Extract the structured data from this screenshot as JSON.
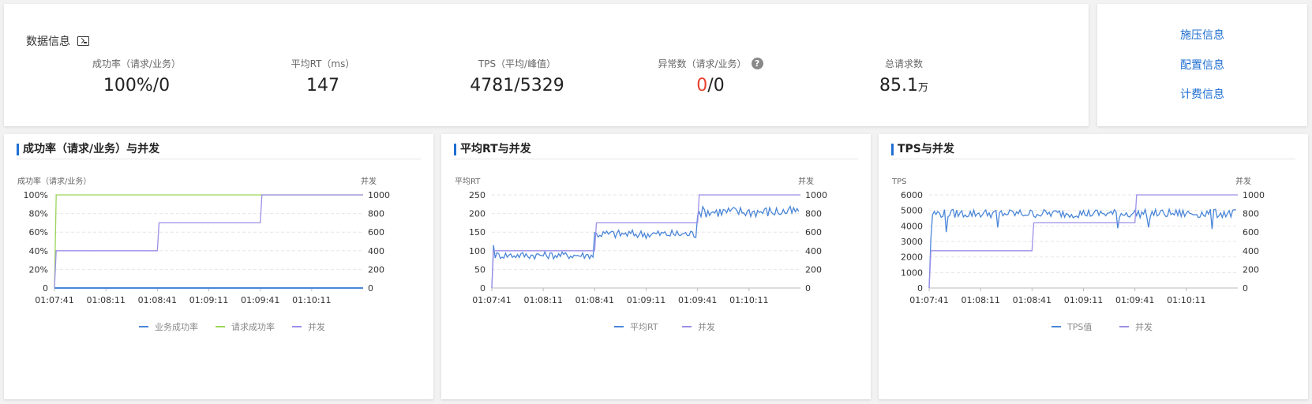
{
  "info": {
    "title": "数据信息",
    "metrics": [
      {
        "label": "成功率（请求/业务）",
        "value": "100%/0"
      },
      {
        "label": "平均RT（ms）",
        "value": "147"
      },
      {
        "label": "TPS（平均/峰值）",
        "value": "4781/5329"
      },
      {
        "label": "异常数（请求/业务）",
        "value_red": "0",
        "value_rest": "/0",
        "help": "?"
      },
      {
        "label": "总请求数",
        "value": "85.1",
        "unit": "万"
      }
    ]
  },
  "links": [
    {
      "label": "施压信息"
    },
    {
      "label": "配置信息"
    },
    {
      "label": "计费信息"
    }
  ],
  "colors": {
    "blue": "#4a86d8",
    "green": "#9bd55a",
    "purple": "#9c8fe8",
    "link": "#1f6fd1",
    "red": "#e8412f"
  },
  "chart_data": [
    {
      "type": "line",
      "title": "成功率（请求/业务）与并发",
      "ylabel_left": "成功率（请求/业务）",
      "ylabel_right": "并发",
      "y_left_ticks": [
        "0",
        "20%",
        "40%",
        "60%",
        "80%",
        "100%"
      ],
      "y_left_range": [
        0,
        100
      ],
      "y_right_ticks": [
        "0",
        "200",
        "400",
        "600",
        "800",
        "1000"
      ],
      "y_right_range": [
        0,
        1000
      ],
      "x_ticks": [
        "01:07:41",
        "01:08:11",
        "01:08:41",
        "01:09:11",
        "01:09:41",
        "01:10:11"
      ],
      "x_range": [
        0,
        180
      ],
      "grid": true,
      "legend_position": "bottom",
      "series": [
        {
          "name": "业务成功率",
          "color": "#4a86d8",
          "axis": "left",
          "kind": "flat",
          "value": 0
        },
        {
          "name": "请求成功率",
          "color": "#9bd55a",
          "axis": "left",
          "kind": "points",
          "x": [
            0,
            1,
            180
          ],
          "y": [
            0,
            100,
            100
          ]
        },
        {
          "name": "并发",
          "color": "#9c8fe8",
          "axis": "right",
          "kind": "steps",
          "steps": [
            [
              0,
              400
            ],
            [
              60,
              700
            ],
            [
              120,
              1000
            ]
          ]
        }
      ]
    },
    {
      "type": "line",
      "title": "平均RT与并发",
      "ylabel_left": "平均RT",
      "ylabel_right": "并发",
      "y_left_ticks": [
        "0",
        "50",
        "100",
        "150",
        "200",
        "250"
      ],
      "y_left_range": [
        0,
        250
      ],
      "y_right_ticks": [
        "0",
        "200",
        "400",
        "600",
        "800",
        "1000"
      ],
      "y_right_range": [
        0,
        1000
      ],
      "x_ticks": [
        "01:07:41",
        "01:08:11",
        "01:08:41",
        "01:09:11",
        "01:09:41",
        "01:10:11"
      ],
      "x_range": [
        0,
        180
      ],
      "grid": true,
      "legend_position": "bottom",
      "series": [
        {
          "name": "平均RT",
          "color": "#4a86d8",
          "axis": "left",
          "kind": "noisy",
          "segments": [
            [
              0,
              60,
              88,
              10
            ],
            [
              60,
              120,
              145,
              12
            ],
            [
              120,
              180,
              205,
              15
            ]
          ],
          "start": [
            0,
            0
          ],
          "peak": [
            1,
            115
          ]
        },
        {
          "name": "并发",
          "color": "#9c8fe8",
          "axis": "right",
          "kind": "steps",
          "steps": [
            [
              0,
              400
            ],
            [
              60,
              700
            ],
            [
              120,
              1000
            ]
          ]
        }
      ]
    },
    {
      "type": "line",
      "title": "TPS与并发",
      "ylabel_left": "TPS",
      "ylabel_right": "并发",
      "y_left_ticks": [
        "0",
        "1000",
        "2000",
        "3000",
        "4000",
        "5000",
        "6000"
      ],
      "y_left_range": [
        0,
        6000
      ],
      "y_right_ticks": [
        "0",
        "200",
        "400",
        "600",
        "800",
        "1000"
      ],
      "y_right_range": [
        0,
        1000
      ],
      "x_ticks": [
        "01:07:41",
        "01:08:11",
        "01:08:41",
        "01:09:11",
        "01:09:41",
        "01:10:11"
      ],
      "x_range": [
        0,
        180
      ],
      "grid": true,
      "legend_position": "bottom",
      "series": [
        {
          "name": "TPS值",
          "color": "#4a86d8",
          "axis": "left",
          "kind": "noisy",
          "segments": [
            [
              2,
              180,
              4800,
              280
            ]
          ],
          "start": [
            0,
            0
          ],
          "peak": [
            1,
            3200
          ],
          "dips": [
            [
              10,
              3600
            ],
            [
              40,
              3900
            ],
            [
              110,
              3850
            ],
            [
              128,
              3900
            ],
            [
              165,
              3800
            ]
          ]
        },
        {
          "name": "并发",
          "color": "#9c8fe8",
          "axis": "right",
          "kind": "steps",
          "steps": [
            [
              0,
              400
            ],
            [
              60,
              700
            ],
            [
              120,
              1000
            ]
          ]
        }
      ]
    }
  ]
}
